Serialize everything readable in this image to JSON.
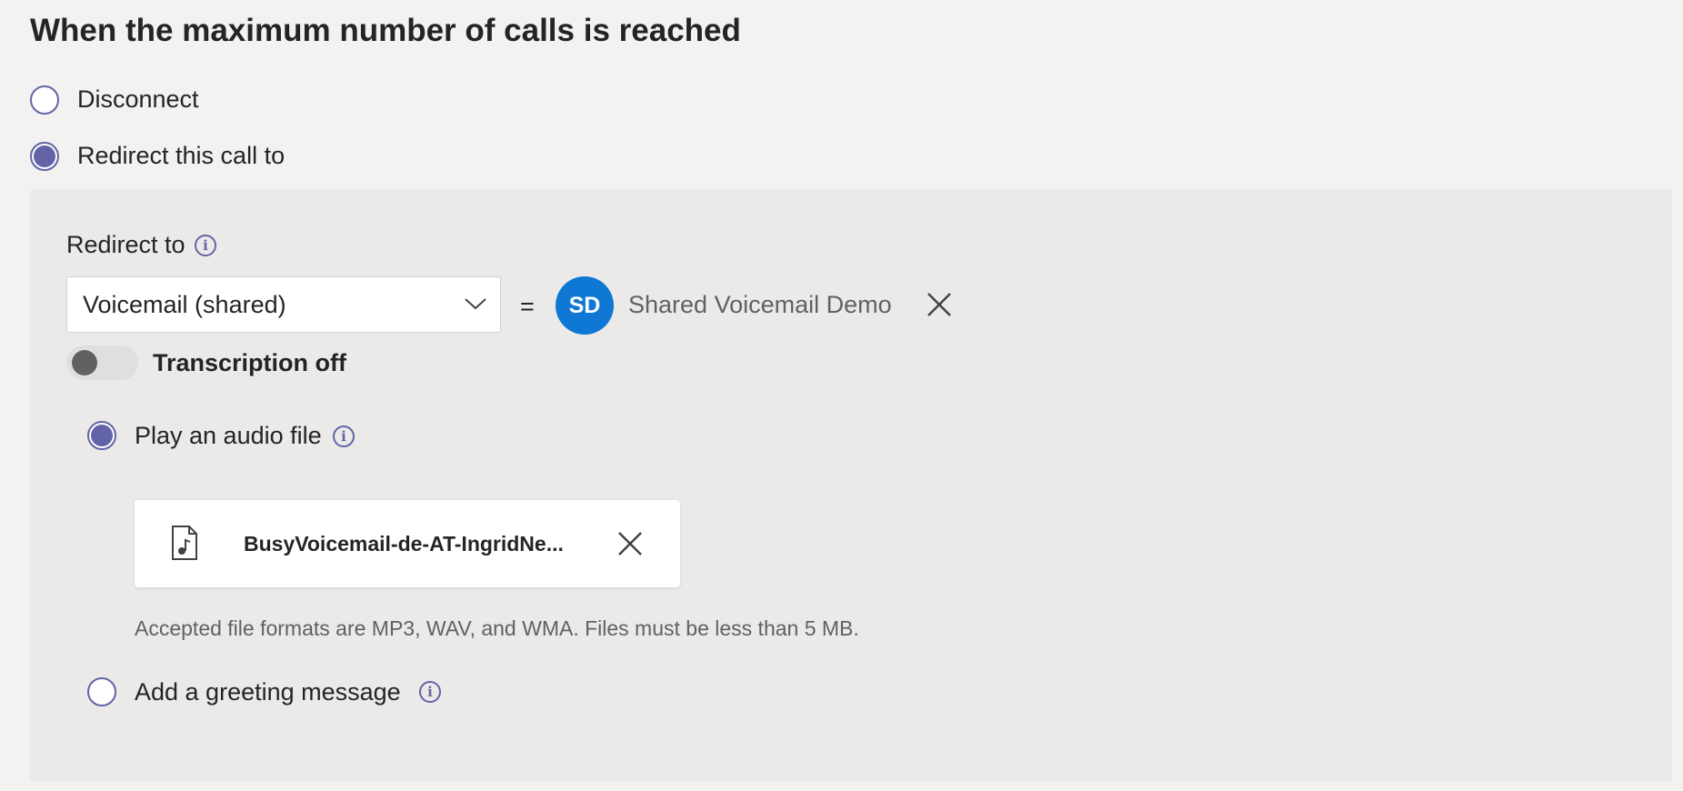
{
  "section_title": "When the maximum number of calls is reached",
  "options": {
    "disconnect_label": "Disconnect",
    "redirect_label": "Redirect this call to",
    "selected": "Redirect this call to"
  },
  "redirect": {
    "label": "Redirect to",
    "dropdown_value": "Voicemail (shared)",
    "equals": "=",
    "target_initials": "SD",
    "target_name": "Shared Voicemail Demo",
    "avatar_color": "#0f78d4"
  },
  "transcription": {
    "label": "Transcription off",
    "state": "off"
  },
  "greeting": {
    "play_audio_label": "Play an audio file",
    "add_greeting_label": "Add a greeting message",
    "selected": "Play an audio file",
    "file_name": "BusyVoicemail-de-AT-IngridNe...",
    "hint": "Accepted file formats are MP3, WAV, and WMA. Files must be less than 5 MB."
  },
  "accent_color": "#6264a7",
  "icons": [
    "info-icon",
    "chevron-down-icon",
    "close-icon",
    "audio-file-icon"
  ]
}
